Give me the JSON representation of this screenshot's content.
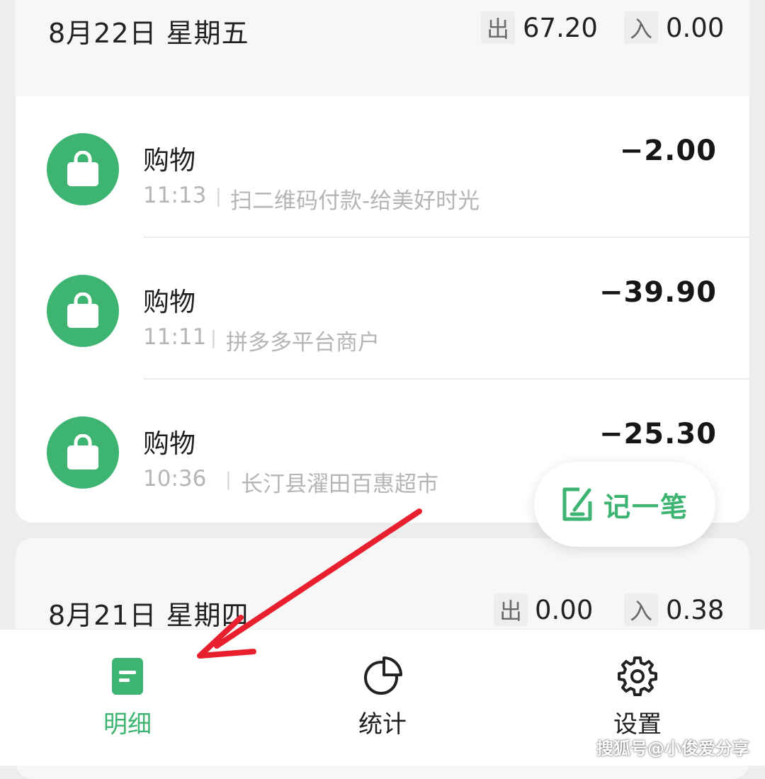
{
  "day1": {
    "date": "8月22日 星期五",
    "out_label": "出",
    "out_value": "67.20",
    "in_label": "入",
    "in_value": "0.00",
    "transactions": [
      {
        "category": "购物",
        "time": "11:13",
        "desc": "扫二维码付款-给美好时光",
        "amount": "−2.00"
      },
      {
        "category": "购物",
        "time": "11:11",
        "desc": "拼多多平台商户",
        "amount": "−39.90"
      },
      {
        "category": "购物",
        "time": "10:36",
        "desc": "长汀县濯田百惠超市",
        "amount": "−25.30"
      }
    ]
  },
  "day2": {
    "date": "8月21日 星期四",
    "out_label": "出",
    "out_value": "0.00",
    "in_label": "入",
    "in_value": "0.38"
  },
  "fab": {
    "label": "记一笔",
    "icon": "note-edit-icon"
  },
  "tabs": [
    {
      "label": "明细",
      "icon": "document-icon",
      "active": true
    },
    {
      "label": "统计",
      "icon": "pie-chart-icon",
      "active": false
    },
    {
      "label": "设置",
      "icon": "gear-icon",
      "active": false
    }
  ],
  "watermark": "搜狐号@小俊爱分享",
  "colors": {
    "accent": "#3db471",
    "annotation_arrow": "#e8202e"
  }
}
